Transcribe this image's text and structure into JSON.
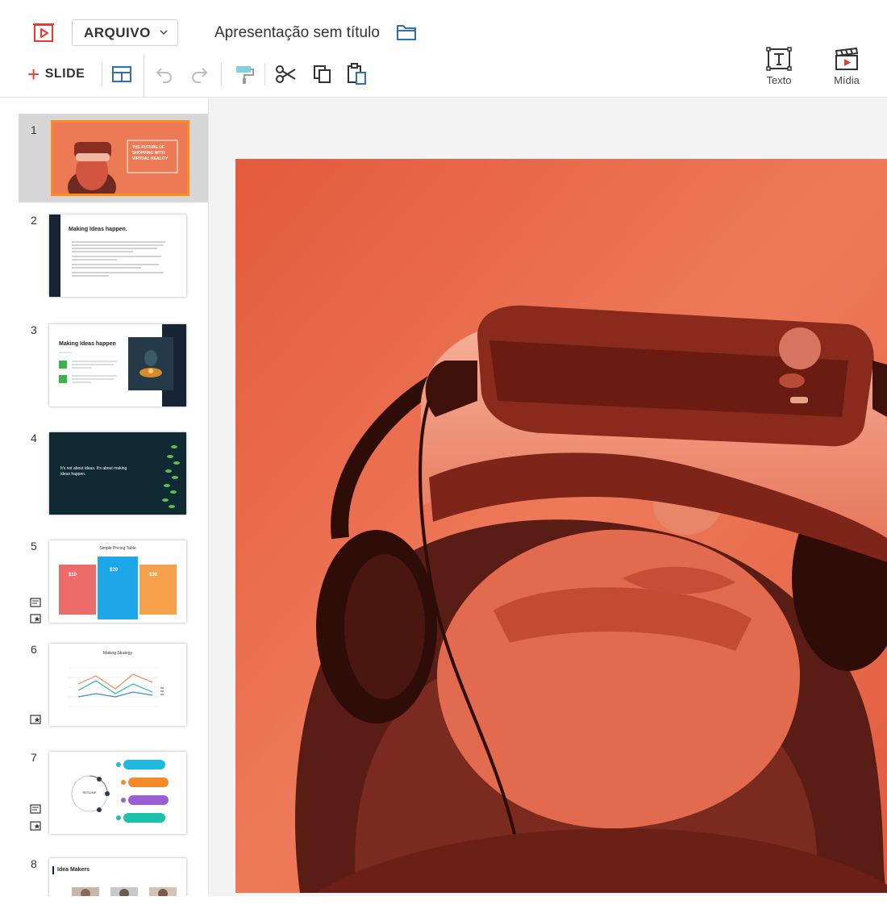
{
  "header": {
    "file_menu_label": "ARQUIVO",
    "document_title": "Apresentação sem título"
  },
  "toolbar": {
    "add_slide_label": "SLIDE",
    "insert_text_label": "Texto",
    "insert_media_label": "Mídia"
  },
  "slides": [
    {
      "number": "1",
      "title_lines": [
        "THE FUTURE OF",
        "SHOPPING WITH",
        "VIRTUAL REALITY"
      ],
      "selected": true
    },
    {
      "number": "2",
      "title": "Making Ideas happen."
    },
    {
      "number": "3",
      "title": "Making Ideas happen"
    },
    {
      "number": "4",
      "title_lines": [
        "It's not about ideas. It's about making",
        "ideas happen."
      ]
    },
    {
      "number": "5",
      "title": "Simple Pricing Table",
      "prices": [
        "$10",
        "$20",
        "$30"
      ]
    },
    {
      "number": "6",
      "title": "Making Strategy"
    },
    {
      "number": "7",
      "center_label": "RESUME"
    },
    {
      "number": "8",
      "title": "Idea Makers"
    }
  ],
  "colors": {
    "accent_red": "#e63b2e",
    "selected_border": "#ff8a1c",
    "slide_photo_tint": "#e8603f"
  }
}
